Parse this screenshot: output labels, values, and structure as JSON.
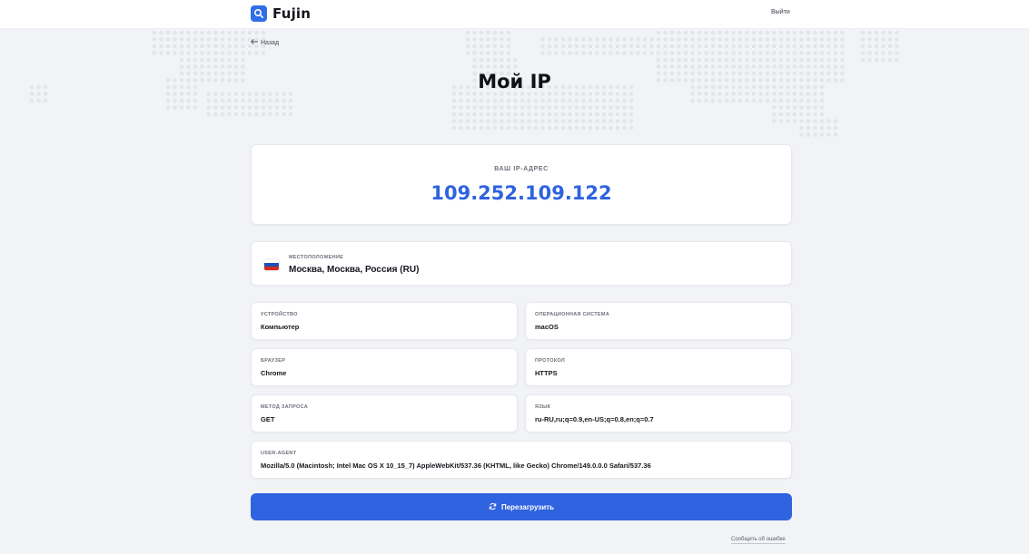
{
  "header": {
    "logo_text": "Fujin",
    "logout_label": "Выйти"
  },
  "nav": {
    "back_label": "Назад"
  },
  "page": {
    "title": "Мой IP"
  },
  "ip": {
    "label": "ВАШ IP-АДРЕС",
    "value": "109.252.109.122"
  },
  "location": {
    "label": "МЕСТОПОЛОЖЕНИЕ",
    "value": "Москва, Москва, Россия (RU)",
    "flag_colors": [
      "#ffffff",
      "#1c50b8",
      "#d52b1e"
    ]
  },
  "details": {
    "device": {
      "label": "УСТРОЙСТВО",
      "value": "Компьютер"
    },
    "os": {
      "label": "ОПЕРАЦИОННАЯ СИСТЕМА",
      "value": "macOS"
    },
    "browser": {
      "label": "БРАУЗЕР",
      "value": "Chrome"
    },
    "protocol": {
      "label": "ПРОТОКОЛ",
      "value": "HTTPS"
    },
    "method": {
      "label": "МЕТОД ЗАПРОСА",
      "value": "GET"
    },
    "language": {
      "label": "ЯЗЫК",
      "value": "ru-RU,ru;q=0.9,en-US;q=0.8,en;q=0.7"
    },
    "user_agent": {
      "label": "USER-AGENT",
      "value": "Mozilla/5.0 (Macintosh; Intel Mac OS X 10_15_7) AppleWebKit/537.36 (KHTML, like Gecko) Chrome/149.0.0.0 Safari/537.36"
    }
  },
  "actions": {
    "reload_label": "Перезагрузить",
    "report_label": "Сообщить об ошибке"
  },
  "colors": {
    "accent": "#2f63df",
    "background": "#f2f3f6",
    "card": "#ffffff",
    "map_dots": "#e3e5ea"
  },
  "icons": {
    "logo": "search-icon",
    "back": "arrow-left-icon",
    "reload": "refresh-icon"
  }
}
